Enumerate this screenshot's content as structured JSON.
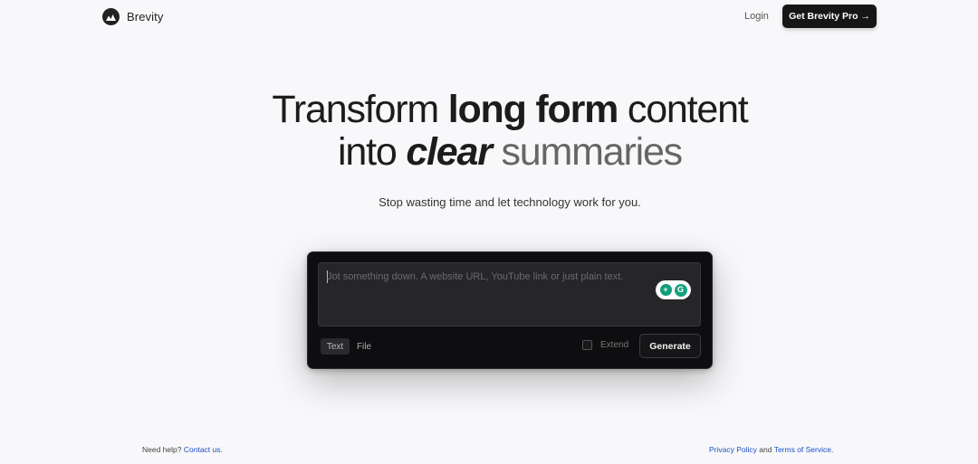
{
  "header": {
    "brand": "Brevity",
    "login_label": "Login",
    "pro_button_label": "Get Brevity Pro →"
  },
  "hero": {
    "line1_a": "Transform",
    "line1_b": "long form",
    "line1_c": "content",
    "line2_a": "into",
    "line2_b": "clear",
    "line2_c": "summaries",
    "subtitle": "Stop wasting time and let technology work for you."
  },
  "input_card": {
    "placeholder": "Jot something down. A website URL, YouTube link or just plain text.",
    "value": "",
    "tabs": [
      "Text",
      "File"
    ],
    "active_tab": "Text",
    "extend_label": "Extend",
    "extend_checked": false,
    "generate_label": "Generate",
    "extension_badge": {
      "plus": "+",
      "grammarly": "G"
    }
  },
  "footer": {
    "help_text": "Need help?",
    "contact_link": "Contact us",
    "contact_suffix": ".",
    "privacy_link": "Privacy Policy",
    "and_text": "and",
    "terms_link": "Terms of Service",
    "terms_suffix": "."
  },
  "colors": {
    "background": "#f8f8fa",
    "card": "#0e0e10",
    "link": "#1b4fc4",
    "accent_green": "#15a37f"
  }
}
